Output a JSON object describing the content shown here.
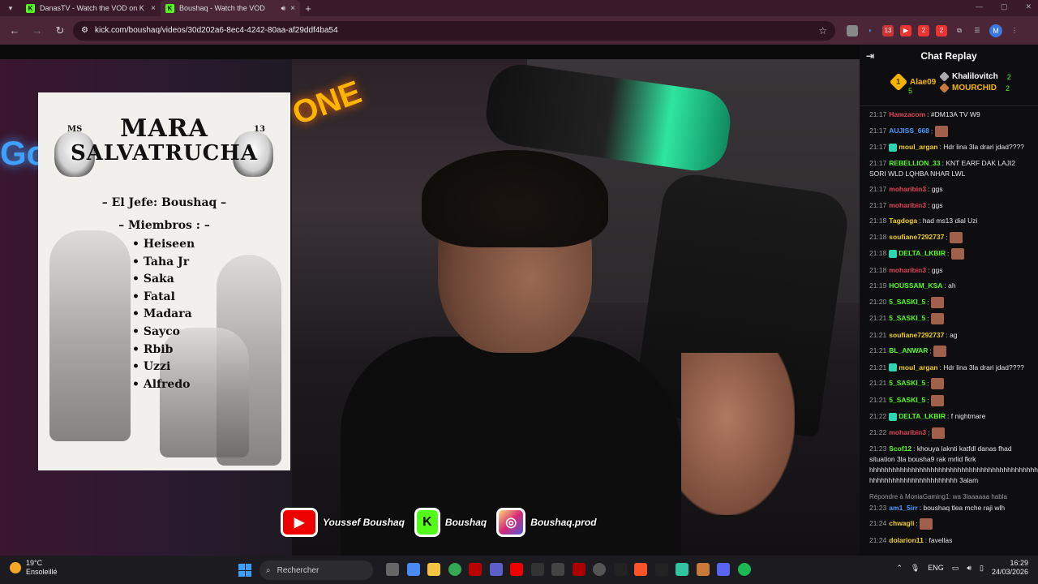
{
  "browser": {
    "tabs": [
      {
        "label": "DanasTV - Watch the VOD on K",
        "close": "×"
      },
      {
        "label": "Boushaq - Watch the VOD",
        "close": "×"
      }
    ],
    "new_tab": "+",
    "url": "kick.com/boushaq/videos/30d202a6-8ec4-4242-80aa-af29ddf4ba54",
    "profile_initial": "M",
    "ext_badges": [
      "13",
      "2",
      "2"
    ]
  },
  "poster": {
    "tag_left": "MS",
    "tag_right": "13",
    "title_line1": "MARA",
    "title_line2": "SALVATRUCHA",
    "jefe": "– El Jefe: Boushaq –",
    "miembros_heading": "– Miembros : –",
    "members": [
      "Heiseen",
      "Taha Jr",
      "Saka",
      "Fatal",
      "Madara",
      "Sayco",
      "Rbib",
      "Uzzi",
      "Alfredo"
    ]
  },
  "social": {
    "youtube": "Youssef Boushaq",
    "kick": "Boushaq",
    "instagram": "Boushaq.prod"
  },
  "chat": {
    "title": "Chat Replay",
    "leaderboard": [
      {
        "rank": "1",
        "name": "Alae09",
        "count": "5"
      },
      {
        "name": "Khalilovitch",
        "count": "2"
      },
      {
        "name": "MOURCHID",
        "count": "2"
      }
    ],
    "messages": [
      {
        "ts": "21:17",
        "user": "Hamzacom",
        "color": "#e0445a",
        "text": "#DM13A TV W9"
      },
      {
        "ts": "21:17",
        "user": "AUJISS_668",
        "color": "#4a9bff",
        "text": "",
        "emote": true
      },
      {
        "ts": "21:17",
        "user": "moul_argan",
        "color": "#f0d020",
        "text": "Hdr lina 3la drari jdad????",
        "badges": true
      },
      {
        "ts": "21:17",
        "user": "REBELLION_33",
        "color": "#53fc18",
        "text": "KNT EARF DAK LAJI2 SORI WLD LQHBA NHAR LWL"
      },
      {
        "ts": "21:17",
        "user": "moharibin3",
        "color": "#e0445a",
        "text": "ggs"
      },
      {
        "ts": "21:17",
        "user": "moharibin3",
        "color": "#e0445a",
        "text": "ggs"
      },
      {
        "ts": "21:18",
        "user": "Tagdoga",
        "color": "#f0d020",
        "text": "had ms13 dial Uzi"
      },
      {
        "ts": "21:18",
        "user": "soufiane7292737",
        "color": "#f0d020",
        "text": "",
        "emote": true
      },
      {
        "ts": "21:18",
        "user": "DELTA_LKBIR",
        "color": "#53fc18",
        "text": "",
        "emote": true,
        "badges": true
      },
      {
        "ts": "21:18",
        "user": "moharibin3",
        "color": "#e0445a",
        "text": "ggs"
      },
      {
        "ts": "21:19",
        "user": "HOUSSAM_KSA",
        "color": "#53fc18",
        "text": "ah"
      },
      {
        "ts": "21:20",
        "user": "5_SASKI_5",
        "color": "#53fc18",
        "text": "",
        "emote": true
      },
      {
        "ts": "21:21",
        "user": "5_SASKI_5",
        "color": "#53fc18",
        "text": "",
        "emote": true
      },
      {
        "ts": "21:21",
        "user": "soufiane7292737",
        "color": "#f0d020",
        "text": "ag"
      },
      {
        "ts": "21:21",
        "user": "BL_ANWAR",
        "color": "#53fc18",
        "text": "",
        "emote": true
      },
      {
        "ts": "21:21",
        "user": "moul_argan",
        "color": "#f0d020",
        "text": "Hdr lina 3la drari jdad????",
        "badges": true
      },
      {
        "ts": "21:21",
        "user": "5_SASKI_5",
        "color": "#53fc18",
        "text": "",
        "emote": true
      },
      {
        "ts": "21:21",
        "user": "5_SASKI_5",
        "color": "#53fc18",
        "text": "",
        "emote": true
      },
      {
        "ts": "21:22",
        "user": "DELTA_LKBIR",
        "color": "#53fc18",
        "text": "f nightmare",
        "badges": true
      },
      {
        "ts": "21:22",
        "user": "moharibin3",
        "color": "#e0445a",
        "text": "",
        "emote": true
      },
      {
        "ts": "21:23",
        "user": "Scof12",
        "color": "#53fc18",
        "text": "khouya laknti katfdl danas fhad situation 3la bousha9 rak mrlid fkrk hhhhhhhhhhhhhhhhhhhhhhhhhhhhhhhhhhhhhhhhhhhh hhhhhhhhhhhhhhhhhhhhhhh 3alam"
      },
      {
        "ts": "21:23",
        "user": "am1_5irr",
        "color": "#4a9bff",
        "text": "boushaq tlea mche raji wlh",
        "reply": "Répondre à MoniaGaming1: wa 3laaaaaa habla"
      },
      {
        "ts": "21:24",
        "user": "chwagli",
        "color": "#f0d020",
        "text": "",
        "emote": true
      },
      {
        "ts": "21:24",
        "user": "dolarion11",
        "color": "#f0d020",
        "text": "favellas"
      }
    ]
  },
  "taskbar": {
    "temp": "19°C",
    "condition": "Ensoleillé",
    "search_placeholder": "Rechercher",
    "lang": "ENG",
    "time": "16:29",
    "date": "24/03/2026"
  },
  "colors": {
    "kick_green": "#53fc18",
    "browser_frame": "#4a2636",
    "chat_bg": "#0e0e10"
  }
}
